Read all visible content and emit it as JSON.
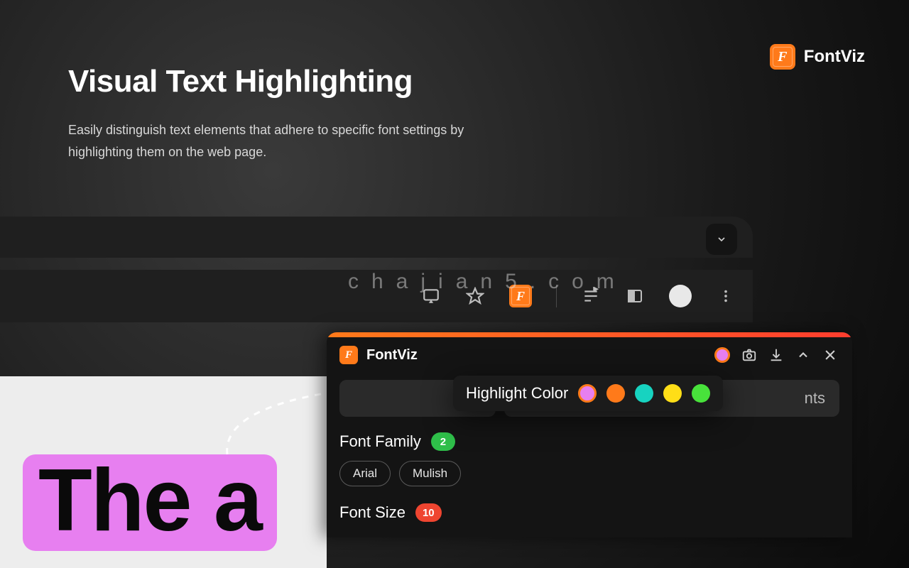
{
  "brand": {
    "name": "FontViz"
  },
  "hero": {
    "title": "Visual Text Highlighting",
    "subtitle": "Easily distinguish text elements that adhere to specific font settings by highlighting them on the web page."
  },
  "watermark": "chajian5.com",
  "page_preview": {
    "highlighted_sample": "The a"
  },
  "extension": {
    "title": "FontViz",
    "search_placeholder": "",
    "nts_trail": "nts",
    "highlight_color": {
      "label": "Highlight Color",
      "colors": [
        "#e77ff0",
        "#ff7a1a",
        "#17d3c0",
        "#ffde17",
        "#48e23b"
      ],
      "selected_index": 0
    },
    "sections": [
      {
        "label": "Font Family",
        "count": 2,
        "badge_color": "green",
        "chips": [
          "Arial",
          "Mulish"
        ]
      },
      {
        "label": "Font Size",
        "count": 10,
        "badge_color": "red",
        "chips": []
      }
    ]
  }
}
